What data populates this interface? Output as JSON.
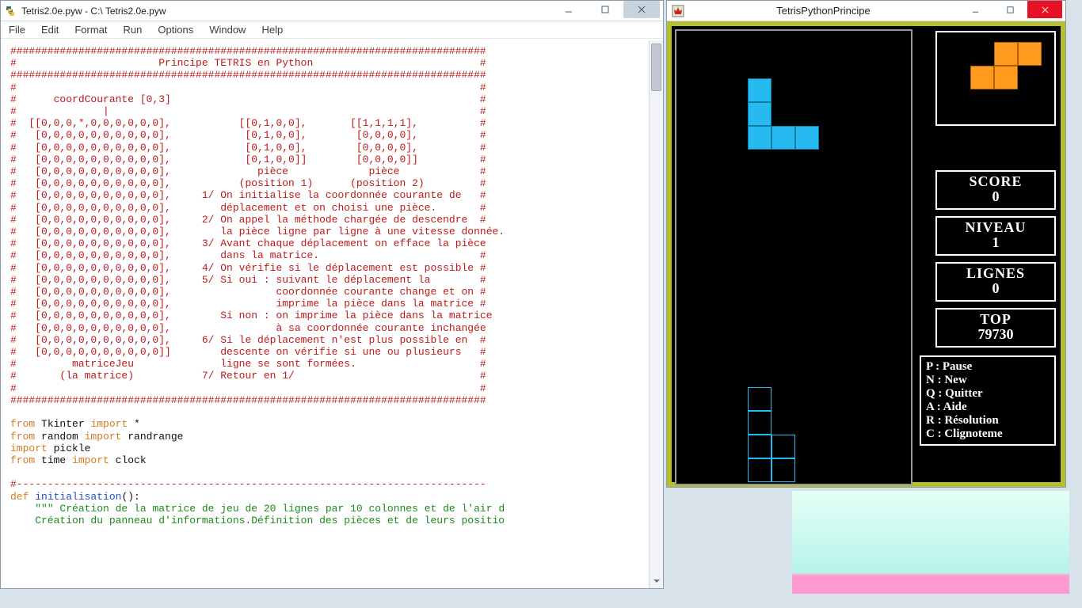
{
  "idle": {
    "title": "Tetris2.0e.pyw - C:\\ Tetris2.0e.pyw",
    "menu": [
      "File",
      "Edit",
      "Format",
      "Run",
      "Options",
      "Window",
      "Help"
    ],
    "code_lines": [
      {
        "cls": "c-comment",
        "t": "#############################################################################"
      },
      {
        "cls": "c-comment",
        "t": "#                       Principe TETRIS en Python                           #"
      },
      {
        "cls": "c-comment",
        "t": "#############################################################################"
      },
      {
        "cls": "c-comment",
        "t": "#                                                                           #"
      },
      {
        "cls": "c-comment",
        "t": "#      coordCourante [0,3]                                                  #"
      },
      {
        "cls": "c-comment",
        "t": "#              |                                                            #"
      },
      {
        "cls": "c-comment",
        "t": "#  [[0,0,0,*,0,0,0,0,0,0],           [[0,1,0,0],       [[1,1,1,1],          #"
      },
      {
        "cls": "c-comment",
        "t": "#   [0,0,0,0,0,0,0,0,0,0],            [0,1,0,0],        [0,0,0,0],          #"
      },
      {
        "cls": "c-comment",
        "t": "#   [0,0,0,0,0,0,0,0,0,0],            [0,1,0,0],        [0,0,0,0],          #"
      },
      {
        "cls": "c-comment",
        "t": "#   [0,0,0,0,0,0,0,0,0,0],            [0,1,0,0]]        [0,0,0,0]]          #"
      },
      {
        "cls": "c-comment",
        "t": "#   [0,0,0,0,0,0,0,0,0,0],              pièce             pièce             #"
      },
      {
        "cls": "c-comment",
        "t": "#   [0,0,0,0,0,0,0,0,0,0],           (position 1)      (position 2)         #"
      },
      {
        "cls": "c-comment",
        "t": "#   [0,0,0,0,0,0,0,0,0,0],     1/ On initialise la coordonnée courante de   #"
      },
      {
        "cls": "c-comment",
        "t": "#   [0,0,0,0,0,0,0,0,0,0],        déplacement et on choisi une pièce.       #"
      },
      {
        "cls": "c-comment",
        "t": "#   [0,0,0,0,0,0,0,0,0,0],     2/ On appel la méthode chargée de descendre  #"
      },
      {
        "cls": "c-comment",
        "t": "#   [0,0,0,0,0,0,0,0,0,0],        la pièce ligne par ligne à une vitesse donnée."
      },
      {
        "cls": "c-comment",
        "t": "#   [0,0,0,0,0,0,0,0,0,0],     3/ Avant chaque déplacement on efface la pièce"
      },
      {
        "cls": "c-comment",
        "t": "#   [0,0,0,0,0,0,0,0,0,0],        dans la matrice.                          #"
      },
      {
        "cls": "c-comment",
        "t": "#   [0,0,0,0,0,0,0,0,0,0],     4/ On vérifie si le déplacement est possible #"
      },
      {
        "cls": "c-comment",
        "t": "#   [0,0,0,0,0,0,0,0,0,0],     5/ Si oui : suivant le déplacement la        #"
      },
      {
        "cls": "c-comment",
        "t": "#   [0,0,0,0,0,0,0,0,0,0],                 coordonnée courante change et on #"
      },
      {
        "cls": "c-comment",
        "t": "#   [0,0,0,0,0,0,0,0,0,0],                 imprime la pièce dans la matrice #"
      },
      {
        "cls": "c-comment",
        "t": "#   [0,0,0,0,0,0,0,0,0,0],        Si non : on imprime la pièce dans la matrice"
      },
      {
        "cls": "c-comment",
        "t": "#   [0,0,0,0,0,0,0,0,0,0],                 à sa coordonnée courante inchangée"
      },
      {
        "cls": "c-comment",
        "t": "#   [0,0,0,0,0,0,0,0,0,0],     6/ Si le déplacement n'est plus possible en  #"
      },
      {
        "cls": "c-comment",
        "t": "#   [0,0,0,0,0,0,0,0,0,0]]        descente on vérifie si une ou plusieurs   #"
      },
      {
        "cls": "c-comment",
        "t": "#         matriceJeu              ligne se sont formées.                    #"
      },
      {
        "cls": "c-comment",
        "t": "#       (la matrice)           7/ Retour en 1/                              #"
      },
      {
        "cls": "c-comment",
        "t": "#                                                                           #"
      },
      {
        "cls": "c-comment",
        "t": "#############################################################################"
      },
      {
        "cls": "",
        "t": ""
      },
      {
        "cls": "mix",
        "parts": [
          [
            "c-kw",
            "from "
          ],
          [
            "c-id",
            "Tkinter "
          ],
          [
            "c-kw",
            "import "
          ],
          [
            "c-id",
            "*"
          ]
        ]
      },
      {
        "cls": "mix",
        "parts": [
          [
            "c-kw",
            "from "
          ],
          [
            "c-id",
            "random "
          ],
          [
            "c-kw",
            "import "
          ],
          [
            "c-id",
            "randrange"
          ]
        ]
      },
      {
        "cls": "mix",
        "parts": [
          [
            "c-kw",
            "import "
          ],
          [
            "c-id",
            "pickle"
          ]
        ]
      },
      {
        "cls": "mix",
        "parts": [
          [
            "c-kw",
            "from "
          ],
          [
            "c-id",
            "time "
          ],
          [
            "c-kw",
            "import "
          ],
          [
            "c-id",
            "clock"
          ]
        ]
      },
      {
        "cls": "",
        "t": ""
      },
      {
        "cls": "c-comment",
        "t": "#----------------------------------------------------------------------------"
      },
      {
        "cls": "mix",
        "parts": [
          [
            "c-kw",
            "def "
          ],
          [
            "c-blue",
            "initialisation"
          ],
          [
            "c-id",
            "():"
          ]
        ]
      },
      {
        "cls": "mix",
        "parts": [
          [
            "c-id",
            "    "
          ],
          [
            "c-str",
            "\"\"\" Création de la matrice de jeu de 20 lignes par 10 colonnes et de l'air d"
          ]
        ]
      },
      {
        "cls": "c-str",
        "t": "    Création du panneau d'informations.Définition des pièces et de leurs positio"
      }
    ]
  },
  "game": {
    "title": "TetrisPythonPrincipe",
    "colors": {
      "cyan": "#26baf0",
      "orange": "#ff9a1f",
      "olive": "#b7be2f"
    },
    "playfield": {
      "cols": 10,
      "rows": 19,
      "cell": 30,
      "filled": [
        {
          "r": 2,
          "c": 3,
          "style": "cyan"
        },
        {
          "r": 3,
          "c": 3,
          "style": "cyan"
        },
        {
          "r": 4,
          "c": 3,
          "style": "cyan"
        },
        {
          "r": 4,
          "c": 4,
          "style": "cyan"
        },
        {
          "r": 4,
          "c": 5,
          "style": "cyan"
        }
      ],
      "outlined": [
        {
          "r": 15,
          "c": 3
        },
        {
          "r": 16,
          "c": 3
        },
        {
          "r": 17,
          "c": 3
        },
        {
          "r": 18,
          "c": 3
        },
        {
          "r": 17,
          "c": 4
        },
        {
          "r": 18,
          "c": 4
        }
      ]
    },
    "preview": [
      {
        "r": 0,
        "c": 2
      },
      {
        "r": 0,
        "c": 3
      },
      {
        "r": 1,
        "c": 1
      },
      {
        "r": 1,
        "c": 2
      }
    ],
    "stats": [
      {
        "label": "SCORE",
        "value": "0"
      },
      {
        "label": "NIVEAU",
        "value": "1"
      },
      {
        "label": "LIGNES",
        "value": "0"
      },
      {
        "label": "TOP",
        "value": "79730"
      }
    ],
    "help": [
      {
        "k": "P",
        "v": "Pause"
      },
      {
        "k": "N",
        "v": "New"
      },
      {
        "k": "Q",
        "v": "Quitter"
      },
      {
        "k": "A",
        "v": "Aide"
      },
      {
        "k": "R",
        "v": "Résolution"
      },
      {
        "k": "C",
        "v": "Clignoteme"
      }
    ]
  }
}
